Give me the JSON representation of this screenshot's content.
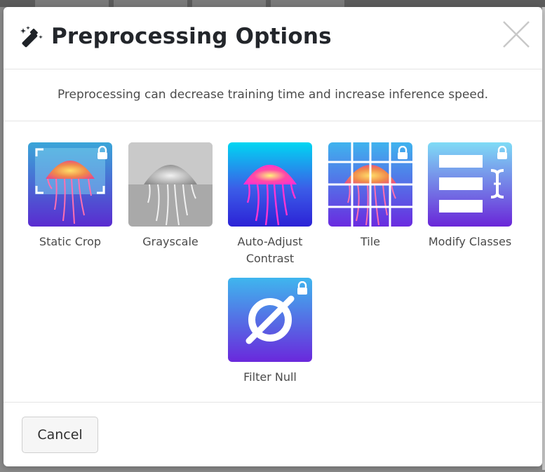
{
  "modal": {
    "title": "Preprocessing Options",
    "subtitle": "Preprocessing can decrease training time and increase inference speed."
  },
  "options": [
    {
      "label": "Static Crop",
      "icon": "static-crop-jellyfish-thumbnail",
      "locked": true
    },
    {
      "label": "Grayscale",
      "icon": "grayscale-jellyfish-thumbnail",
      "locked": false
    },
    {
      "label": "Auto-Adjust Contrast",
      "icon": "contrast-jellyfish-thumbnail",
      "locked": false
    },
    {
      "label": "Tile",
      "icon": "tile-jellyfish-thumbnail",
      "locked": true
    },
    {
      "label": "Modify Classes",
      "icon": "modify-classes-thumbnail",
      "locked": true
    },
    {
      "label": "Filter Null",
      "icon": "filter-null-thumbnail",
      "locked": true
    }
  ],
  "footer": {
    "cancel_label": "Cancel"
  },
  "colors": {
    "accent_blue": "#4fc3f7",
    "accent_purple": "#6a1bd6",
    "text": "#23262b"
  }
}
